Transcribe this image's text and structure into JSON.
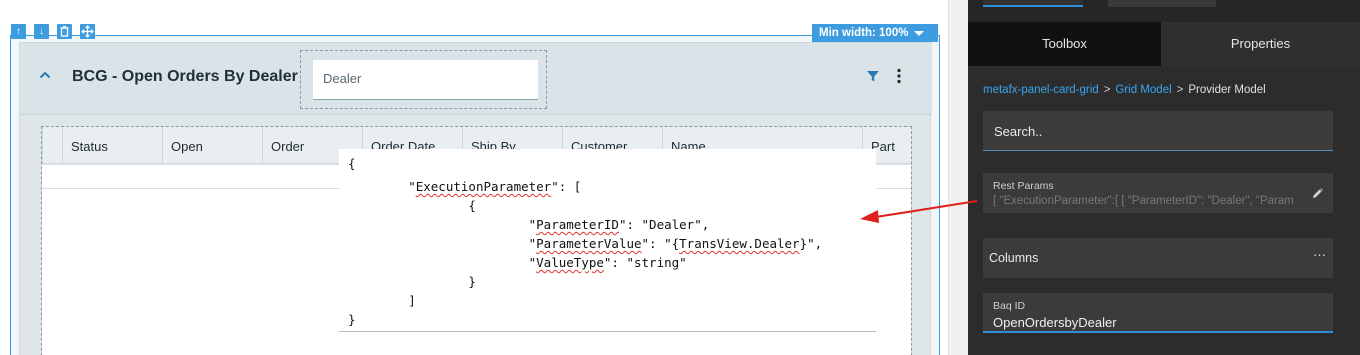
{
  "card": {
    "title": "BCG - Open Orders By Dealer",
    "dealer_placeholder": "Dealer",
    "min_width_label": "Min width: 100%"
  },
  "grid": {
    "columns": [
      "Status",
      "Open",
      "Order",
      "Order Date",
      "Ship By",
      "Customer",
      "Name",
      "Part"
    ]
  },
  "json_popup": {
    "lines": [
      "{",
      "        \"ExecutionParameter\": [",
      "                {",
      "                        \"ParameterID\": \"Dealer\",",
      "                        \"ParameterValue\": \"{TransView.Dealer}\",",
      "                        \"ValueType\": \"string\"",
      "                }",
      "        ]",
      "}"
    ]
  },
  "panel": {
    "tabs": [
      "Toolbox",
      "Properties"
    ],
    "breadcrumb": {
      "link1": "metafx-panel-card-grid",
      "link2": "Grid Model",
      "current": "Provider Model"
    },
    "search_placeholder": "Search..",
    "rest_params": {
      "label": "Rest Params",
      "value": "[ \"ExecutionParameter\":[   [     \"ParameterID\": \"Dealer\", \"ParameterValue\""
    },
    "columns_label": "Columns",
    "columns_menu": "···",
    "baq": {
      "label": "Baq ID",
      "value": "OpenOrdersbyDealer"
    }
  },
  "colors": {
    "accent": "#3d9be0",
    "link": "#3aa5f0",
    "arrow": "#e0201c",
    "panel_bg": "#2c2c2c"
  }
}
